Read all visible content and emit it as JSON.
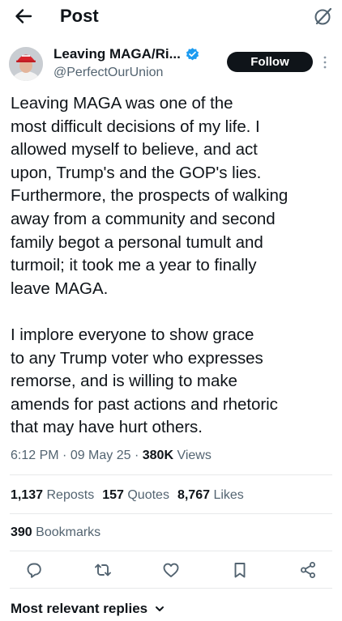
{
  "header": {
    "title": "Post",
    "back_icon": "back-arrow-icon",
    "grok_icon": "grok-icon"
  },
  "author": {
    "name": "Leaving MAGA/Ri...",
    "handle": "@PerfectOurUnion",
    "verified": true,
    "verified_color": "#1d9bf0"
  },
  "follow_label": "Follow",
  "post": {
    "text": "Leaving MAGA was one of the\nmost difficult decisions of my life. I\nallowed myself to believe, and act\nupon, Trump's and the GOP's lies.\nFurthermore, the prospects of walking\naway from a community and second\nfamily begot a personal tumult and\nturmoil; it took me a year to finally\nleave MAGA.\n\nI implore everyone to show grace\nto any Trump voter who expresses\nremorse, and is willing to make\namends for past actions and rhetoric\nthat may have hurt others.",
    "time": "6:12 PM",
    "date": "09 May 25",
    "views_count": "380K",
    "views_label": "Views"
  },
  "stats": {
    "reposts_count": "1,137",
    "reposts_label": "Reposts",
    "quotes_count": "157",
    "quotes_label": "Quotes",
    "likes_count": "8,767",
    "likes_label": "Likes",
    "bookmarks_count": "390",
    "bookmarks_label": "Bookmarks"
  },
  "actions": [
    "reply-icon",
    "repost-icon",
    "like-icon",
    "bookmark-icon",
    "share-icon"
  ],
  "replies_sort": "Most relevant replies",
  "colors": {
    "text": "#0f1419",
    "secondary": "#536471",
    "divider": "#e7e9ea",
    "accent": "#1d9bf0"
  }
}
